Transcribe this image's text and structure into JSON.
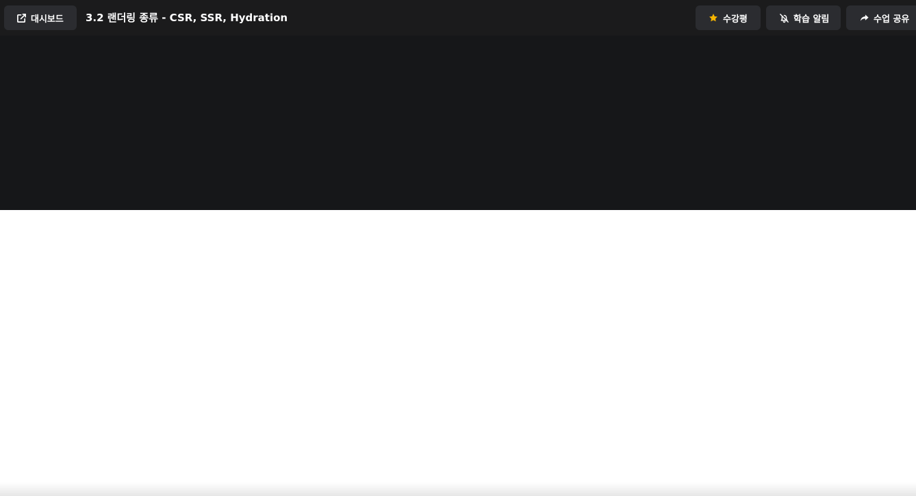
{
  "header": {
    "dashboard_label": "대시보드",
    "lesson_title": "3.2 랜더링 종류 - CSR, SSR, Hydration",
    "review_label": "수강평",
    "alarm_label": "학습 알림",
    "share_label": "수업 공유"
  },
  "icons": {
    "dashboard": "external-link-icon",
    "review": "star-icon",
    "alarm": "bell-off-icon",
    "share": "share-arrow-icon"
  },
  "colors": {
    "header_bg": "#1b1b1c",
    "button_bg": "#2b2c30",
    "video_bg": "#161719",
    "star": "#f5b400"
  }
}
